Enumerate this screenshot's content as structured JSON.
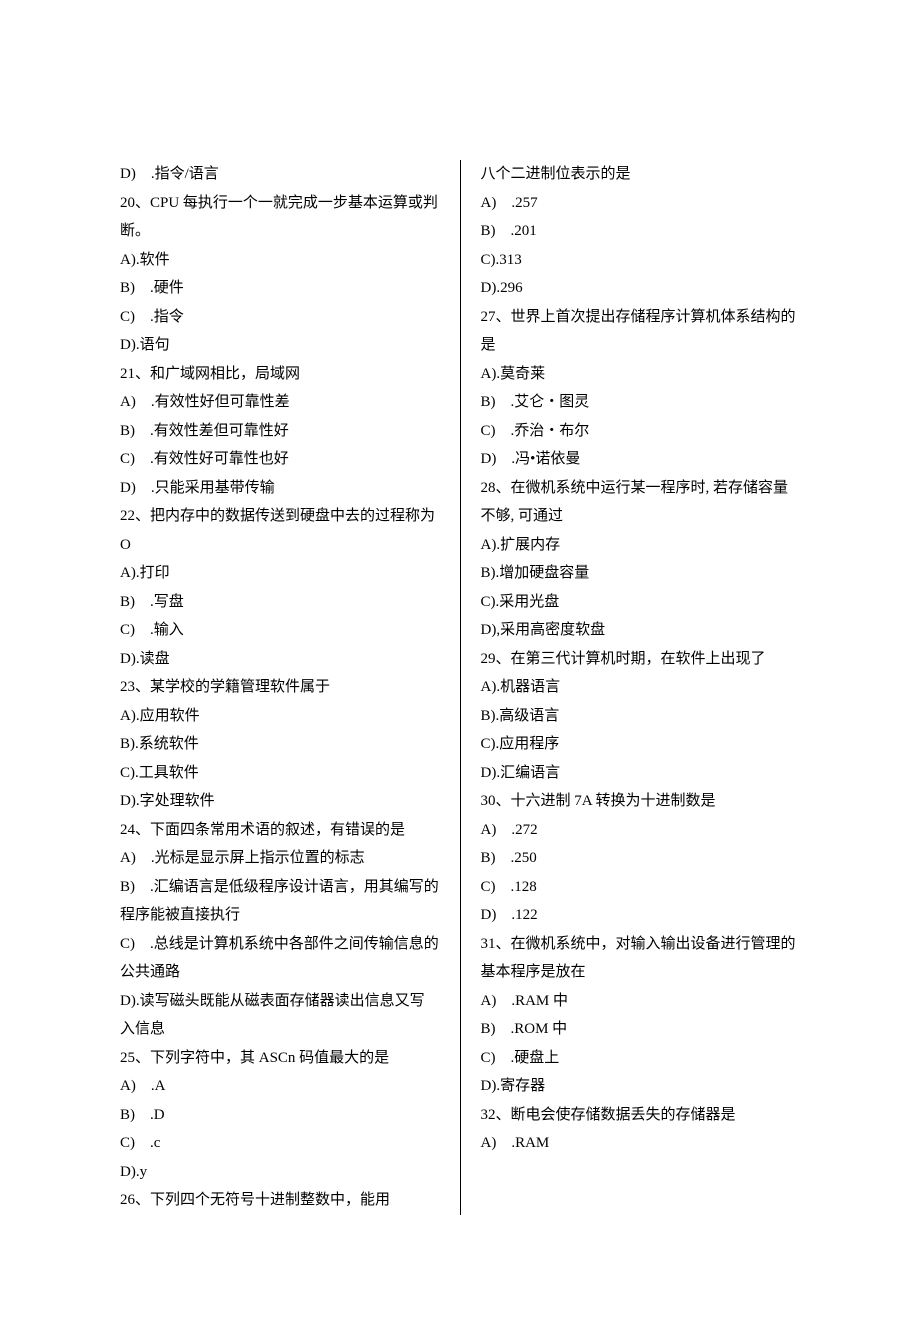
{
  "left": [
    "D)　.指令/语言",
    "20、CPU 每执行一个一就完成一步基本运算或判断。",
    "A).软件",
    "B)　.硬件",
    "C)　.指令",
    "D).语句",
    "21、和广域网相比，局域网",
    "A)　.有效性好但可靠性差",
    "B)　.有效性差但可靠性好",
    "C)　.有效性好可靠性也好",
    "D)　.只能采用基带传输",
    "22、把内存中的数据传送到硬盘中去的过程称为 O",
    "A).打印",
    "B)　.写盘",
    "C)　.输入",
    "D).读盘",
    "23、某学校的学籍管理软件属于",
    "A).应用软件",
    "B).系统软件",
    "C).工具软件",
    "D).字处理软件",
    "24、下面四条常用术语的叙述，有错误的是",
    "A)　.光标是显示屏上指示位置的标志",
    "B)　.汇编语言是低级程序设计语言，用其编写的程序能被直接执行",
    "C)　.总线是计算机系统中各部件之间传输信息的公共通路",
    "D).读写磁头既能从磁表面存储器读出信息又写入信息",
    "25、下列字符中，其 ASCn 码值最大的是",
    "A)　.A",
    "B)　.D",
    "C)　.c",
    "D).y",
    "26、下列四个无符号十进制整数中，能用"
  ],
  "right": [
    "八个二进制位表示的是",
    "A)　.257",
    "B)　.201",
    "C).313",
    "D).296",
    "27、世界上首次提出存储程序计算机体系结构的是",
    "A).莫奇莱",
    "B)　.艾仑・图灵",
    "C)　.乔治・布尔",
    "D)　.冯•诺依曼",
    "28、在微机系统中运行某一程序时, 若存储容量不够, 可通过",
    "A).扩展内存",
    "B).增加硬盘容量",
    "C).采用光盘",
    "D),采用高密度软盘",
    "29、在第三代计算机时期，在软件上出现了",
    "A).机器语言",
    "B).高级语言",
    "C).应用程序",
    "D).汇编语言",
    "30、十六进制 7A 转换为十进制数是",
    "A)　.272",
    "B)　.250",
    "C)　.128",
    "D)　.122",
    "31、在微机系统中，对输入输出设备进行管理的基本程序是放在",
    "A)　.RAM 中",
    "B)　.ROM 中",
    "C)　.硬盘上",
    "D).寄存器",
    "32、断电会使存储数据丢失的存储器是",
    "A)　.RAM"
  ]
}
